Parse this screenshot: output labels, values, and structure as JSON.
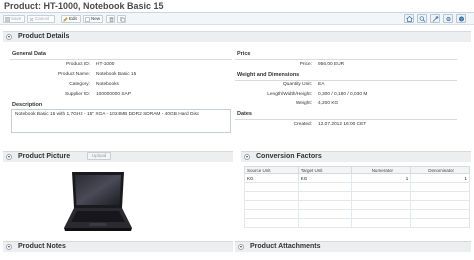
{
  "window": {
    "title": "Product: HT-1000, Notebook Basic 15"
  },
  "toolbar": {
    "save_label": "Save",
    "cancel_label": "Cancel",
    "edit_label": "Edit",
    "new_label": "New",
    "right_icons": [
      "home-icon",
      "search-icon",
      "tools-icon",
      "settings-icon",
      "help-icon"
    ]
  },
  "product_details": {
    "title": "Product Details",
    "general_data": {
      "title": "General Data",
      "fields": [
        {
          "label": "Product ID:",
          "value": "HT-1000"
        },
        {
          "label": "Product Name:",
          "value": "Notebook Basic 15"
        },
        {
          "label": "Category:",
          "value": "Notebooks"
        },
        {
          "label": "Supplier ID:",
          "value": "100000000 SAP"
        }
      ]
    },
    "description": {
      "title": "Description",
      "text": "Notebook Basic 15 with 1,7GHz - 15\" XGA - 1024MB DDR2 SDRAM - 40GB Hard Disc"
    },
    "price": {
      "title": "Price",
      "label": "Price:",
      "value": "956,00 EUR"
    },
    "weight_dimensions": {
      "title": "Weight and Dimensions",
      "fields": [
        {
          "label": "Quantity Unit:",
          "value": "EA"
        },
        {
          "label": "Length/Width/Height:",
          "value": "0,300 / 0,180 / 0,030 M"
        },
        {
          "label": "Weight:",
          "value": "4,200 KG"
        }
      ]
    },
    "dates": {
      "title": "Dates",
      "label": "Created:",
      "value": "12.07.2012 16:00 CET"
    }
  },
  "product_picture": {
    "title": "Product Picture",
    "upload_label": "Upload"
  },
  "conversion_factors": {
    "title": "Conversion Factors",
    "columns": [
      "Source Unit",
      "Target Unit",
      "Numerator",
      "Denominator"
    ],
    "rows": [
      {
        "source": "KG",
        "target": "KG",
        "numerator": "1",
        "denominator": "1"
      }
    ]
  },
  "product_notes": {
    "title": "Product Notes"
  },
  "product_attachments": {
    "title": "Product Attachments"
  },
  "colors": {
    "accent": "#c9d6e3",
    "panel_header": "#eceef0"
  }
}
